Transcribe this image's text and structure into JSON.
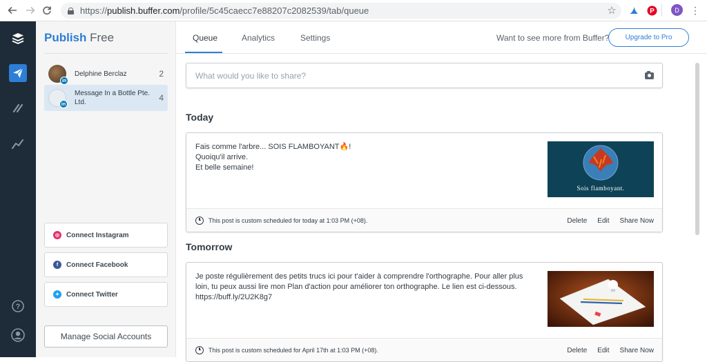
{
  "browser": {
    "url_prefix": "https://",
    "url_host": "publish.buffer.com",
    "url_path": "/profile/5c45caecc7e88207c2082539/tab/queue",
    "back_icon": "arrow-left-icon",
    "forward_icon": "arrow-right-icon",
    "reload_icon": "reload-icon",
    "star_icon": "star-icon",
    "account_initial": "D"
  },
  "rail": {
    "items": [
      {
        "name": "buffer-logo-icon"
      },
      {
        "name": "paper-plane-icon",
        "active": true
      },
      {
        "name": "reply-icon"
      },
      {
        "name": "analytics-icon"
      },
      {
        "name": "help-icon"
      },
      {
        "name": "user-icon"
      }
    ]
  },
  "sidebar": {
    "brand": "Publish",
    "plan": "Free",
    "profiles": [
      {
        "name": "Delphine Berclaz",
        "count": "2",
        "network": "in"
      },
      {
        "name": "Message In a Bottle Pte. Ltd.",
        "count": "4",
        "network": "in",
        "selected": true
      }
    ],
    "connect": [
      {
        "label": "Connect Instagram",
        "color": "#e1306c"
      },
      {
        "label": "Connect Facebook",
        "color": "#3b5998"
      },
      {
        "label": "Connect Twitter",
        "color": "#1da1f2"
      }
    ],
    "manage_label": "Manage Social Accounts"
  },
  "tabs": [
    {
      "label": "Queue",
      "active": true
    },
    {
      "label": "Analytics"
    },
    {
      "label": "Settings"
    }
  ],
  "promo_text": "Want to see more from Buffer?",
  "upgrade_label": "Upgrade to Pro",
  "composer": {
    "placeholder": "What would you like to share?"
  },
  "days": [
    {
      "heading": "Today",
      "post": {
        "text": "Fais comme l'arbre... SOIS FLAMBOYANT🔥!\nQuoiqu'il arrive.\nEt belle semaine!",
        "thumb_caption": "Sois flamboyant.",
        "schedule": "This post is custom scheduled for today at 1:03 PM (+08).",
        "actions": [
          "Delete",
          "Edit",
          "Share Now"
        ]
      }
    },
    {
      "heading": "Tomorrow",
      "post": {
        "text": "Je poste régulièrement des petits trucs ici pour t'aider à comprendre l'orthographe. Pour aller plus\nloin, tu peux aussi lire mon Plan d'action pour améliorer ton orthographe. Le lien est ci-dessous.\nhttps://buff.ly/2U2K8g7",
        "schedule": "This post is custom scheduled for April 17th at 1:03 PM (+08).",
        "actions": [
          "Delete",
          "Edit",
          "Share Now"
        ]
      }
    }
  ],
  "colors": {
    "accent": "#2c7ed6",
    "rail": "#1e2b38",
    "linkedin": "#0077b5"
  }
}
